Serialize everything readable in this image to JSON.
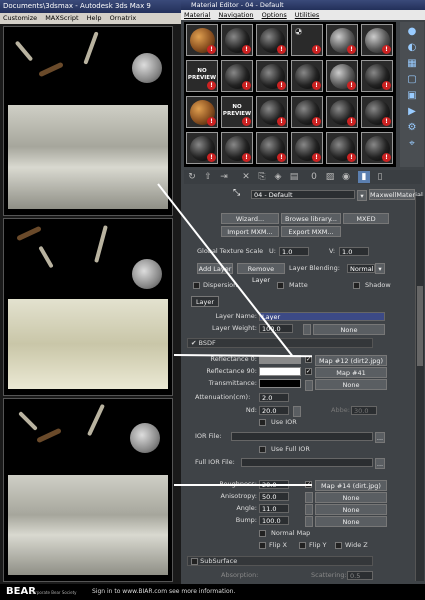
{
  "max_window": {
    "title": "Documents\\3dsmax    -  Autodesk 3ds Max 9",
    "menu": [
      "Customize",
      "MAXScript",
      "Help",
      "Ornatrix"
    ]
  },
  "material_editor": {
    "title": "Material Editor - 04 - Default",
    "menu": [
      "Material",
      "Navigation",
      "Options",
      "Utilities"
    ],
    "slots": [
      {
        "style": "org",
        "warn": true
      },
      {
        "style": "blk",
        "warn": true
      },
      {
        "style": "blk",
        "warn": true
      },
      {
        "style": "chk",
        "warn": true
      },
      {
        "style": "gray",
        "warn": true
      },
      {
        "style": "gray",
        "warn": true
      },
      {
        "style": "nop",
        "label": "NO PREVIEW",
        "warn": true
      },
      {
        "style": "blk",
        "warn": true
      },
      {
        "style": "blk",
        "warn": true
      },
      {
        "style": "blk",
        "warn": true
      },
      {
        "style": "gray",
        "warn": true
      },
      {
        "style": "blk",
        "warn": true
      },
      {
        "style": "org",
        "warn": true
      },
      {
        "style": "nop",
        "label": "NO PREVIEW",
        "warn": true
      },
      {
        "style": "blk",
        "warn": true
      },
      {
        "style": "blk",
        "warn": true
      },
      {
        "style": "blk",
        "warn": true
      },
      {
        "style": "blk",
        "warn": true
      },
      {
        "style": "blk",
        "warn": true
      },
      {
        "style": "blk",
        "warn": true
      },
      {
        "style": "blk",
        "warn": true
      },
      {
        "style": "blk",
        "warn": true
      },
      {
        "style": "blk",
        "warn": true
      },
      {
        "style": "blk",
        "warn": true
      }
    ],
    "material_name": "04 - Default",
    "material_type": "MaxwellMaterial",
    "buttons": {
      "wizard": "Wizard...",
      "browse": "Browse library...",
      "mxed": "MXED",
      "import": "Import MXM...",
      "export": "Export MXM..."
    },
    "global_scale": {
      "label": "Global Texture Scale",
      "u_label": "U:",
      "u": "1.0",
      "v_label": "V:",
      "v": "1.0"
    },
    "layer_buttons": {
      "add": "Add Layer",
      "remove": "Remove Layer",
      "blending_label": "Layer Blending:",
      "blending": "Normal"
    },
    "options": {
      "dispersion": "Dispersion",
      "matte": "Matte",
      "shadow": "Shadow"
    },
    "layer_tab": "Layer",
    "layer_name_label": "Layer Name:",
    "layer_name": "Layer",
    "layer_weight_label": "Layer Weight:",
    "layer_weight": "100.0",
    "none": "None",
    "bsdf_label": "BSDF",
    "reflectance0_label": "Reflectance 0:",
    "reflectance0_map": "Map #12 (dirt2.jpg)",
    "reflectance90_label": "Reflectance 90:",
    "reflectance90_map": "Map #41 (head_ds.jpg)",
    "transmittance_label": "Transmittance:",
    "attenuation_label": "Attenuation(cm):",
    "attenuation": "2.0",
    "nd_label": "Nd:",
    "nd": "20.0",
    "abbe_label": "Abbe:",
    "abbe": "30.0",
    "use_ior": "Use IOR",
    "ior_file_label": "IOR File:",
    "use_full_ior": "Use Full IOR",
    "full_ior_label": "Full IOR File:",
    "roughness_label": "Roughness:",
    "roughness": "20.0",
    "roughness_map": "Map #14 (dirt.jpg)",
    "anisotropy_label": "Anisotropy:",
    "anisotropy": "50.0",
    "angle_label": "Angle:",
    "angle": "11.0",
    "bump_label": "Bump:",
    "bump": "100.0",
    "normal_map": "Normal Map",
    "flip_x": "Flip X",
    "flip_y": "Flip Y",
    "wide_z": "Wide Z",
    "subsurface": "SubSurface",
    "absorption_label": "Absorption:",
    "scattering_label": "Scattering:",
    "scattering": "0.5",
    "ellipsis": "..."
  },
  "footer": {
    "logo": "BEAR",
    "logo_sub": "Corporate Bear Society",
    "text": "Sign in to www.BIAR.com see more information."
  },
  "colors": {
    "panel": "#3f4347",
    "title": "#23305a",
    "accent": "#9cf"
  }
}
